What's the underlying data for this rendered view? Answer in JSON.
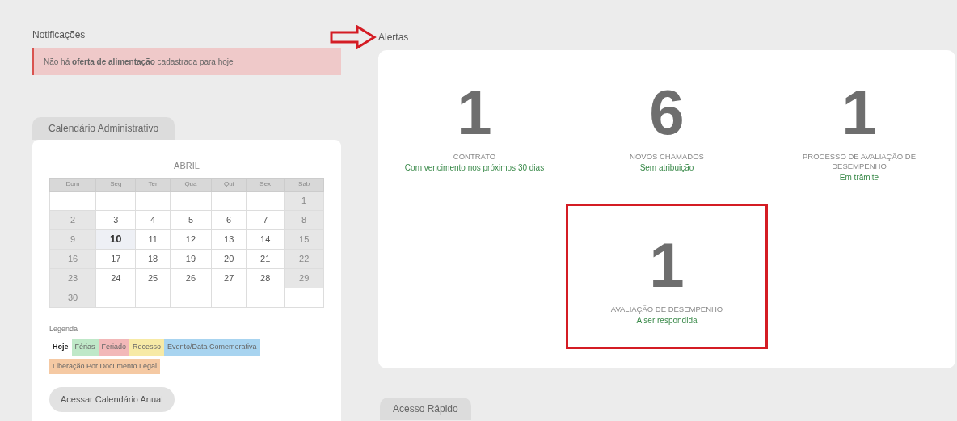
{
  "notifications": {
    "title": "Notificações",
    "message": "Não há **oferta de alimentação** cadastrada para hoje"
  },
  "calendar": {
    "tab": "Calendário Administrativo",
    "month": "ABRIL",
    "weekdays": [
      "Dom",
      "Seg",
      "Ter",
      "Qua",
      "Qui",
      "Sex",
      "Sab"
    ],
    "weeks": [
      [
        {
          "kind": "blank"
        },
        {
          "kind": "blank"
        },
        {
          "kind": "blank"
        },
        {
          "kind": "blank"
        },
        {
          "kind": "blank"
        },
        {
          "kind": "blank"
        },
        {
          "day": "1",
          "today": false
        }
      ],
      [
        {
          "day": "2",
          "today": false
        },
        {
          "day": "3",
          "today": false
        },
        {
          "day": "4",
          "today": false
        },
        {
          "day": "5",
          "today": false
        },
        {
          "day": "6",
          "today": false
        },
        {
          "day": "7",
          "today": false
        },
        {
          "day": "8",
          "today": false
        }
      ],
      [
        {
          "day": "9",
          "today": false
        },
        {
          "day": "10",
          "today": true
        },
        {
          "day": "11",
          "today": false
        },
        {
          "day": "12",
          "today": false
        },
        {
          "day": "13",
          "today": false
        },
        {
          "day": "14",
          "today": false
        },
        {
          "day": "15",
          "today": false
        }
      ],
      [
        {
          "day": "16",
          "today": false
        },
        {
          "day": "17",
          "today": false
        },
        {
          "day": "18",
          "today": false
        },
        {
          "day": "19",
          "today": false
        },
        {
          "day": "20",
          "today": false
        },
        {
          "day": "21",
          "today": false
        },
        {
          "day": "22",
          "today": false
        }
      ],
      [
        {
          "day": "23",
          "today": false
        },
        {
          "day": "24",
          "today": false
        },
        {
          "day": "25",
          "today": false
        },
        {
          "day": "26",
          "today": false
        },
        {
          "day": "27",
          "today": false
        },
        {
          "day": "28",
          "today": false
        },
        {
          "day": "29",
          "today": false
        }
      ],
      [
        {
          "day": "30",
          "today": false
        },
        {
          "kind": "blank"
        },
        {
          "kind": "blank"
        },
        {
          "kind": "blank"
        },
        {
          "kind": "blank"
        },
        {
          "kind": "blank"
        },
        {
          "kind": "blank"
        }
      ]
    ],
    "legend_title": "Legenda",
    "legend": [
      {
        "label": "Hoje",
        "kind": "today"
      },
      {
        "label": "Férias",
        "kind": "swatch",
        "color": "#bfe8c8"
      },
      {
        "label": "Feriado",
        "kind": "swatch",
        "color": "#f2b8b8"
      },
      {
        "label": "Recesso",
        "kind": "swatch",
        "color": "#f7eaa6"
      },
      {
        "label": "Evento/Data Comemorativa",
        "kind": "swatch",
        "color": "#a8d4f0"
      },
      {
        "label": "Liberação Por Documento Legal",
        "kind": "swatch",
        "color": "#f5c9a3"
      }
    ],
    "button": "Acessar Calendário Anual"
  },
  "alerts": {
    "title": "Alertas",
    "cards": [
      {
        "count": "1",
        "title": "CONTRATO",
        "subtitle": "Com vencimento nos próximos 30 dias",
        "highlighted": false
      },
      {
        "count": "6",
        "title": "NOVOS CHAMADOS",
        "subtitle": "Sem atribuição",
        "highlighted": false
      },
      {
        "count": "1",
        "title": "PROCESSO DE AVALIAÇÃO DE DESEMPENHO",
        "subtitle": "Em trâmite",
        "highlighted": false
      },
      {
        "count": "1",
        "title": "AVALIAÇÃO DE DESEMPENHO",
        "subtitle": "A ser respondida",
        "highlighted": true
      }
    ]
  },
  "quick_access": {
    "tab": "Acesso Rápido"
  }
}
